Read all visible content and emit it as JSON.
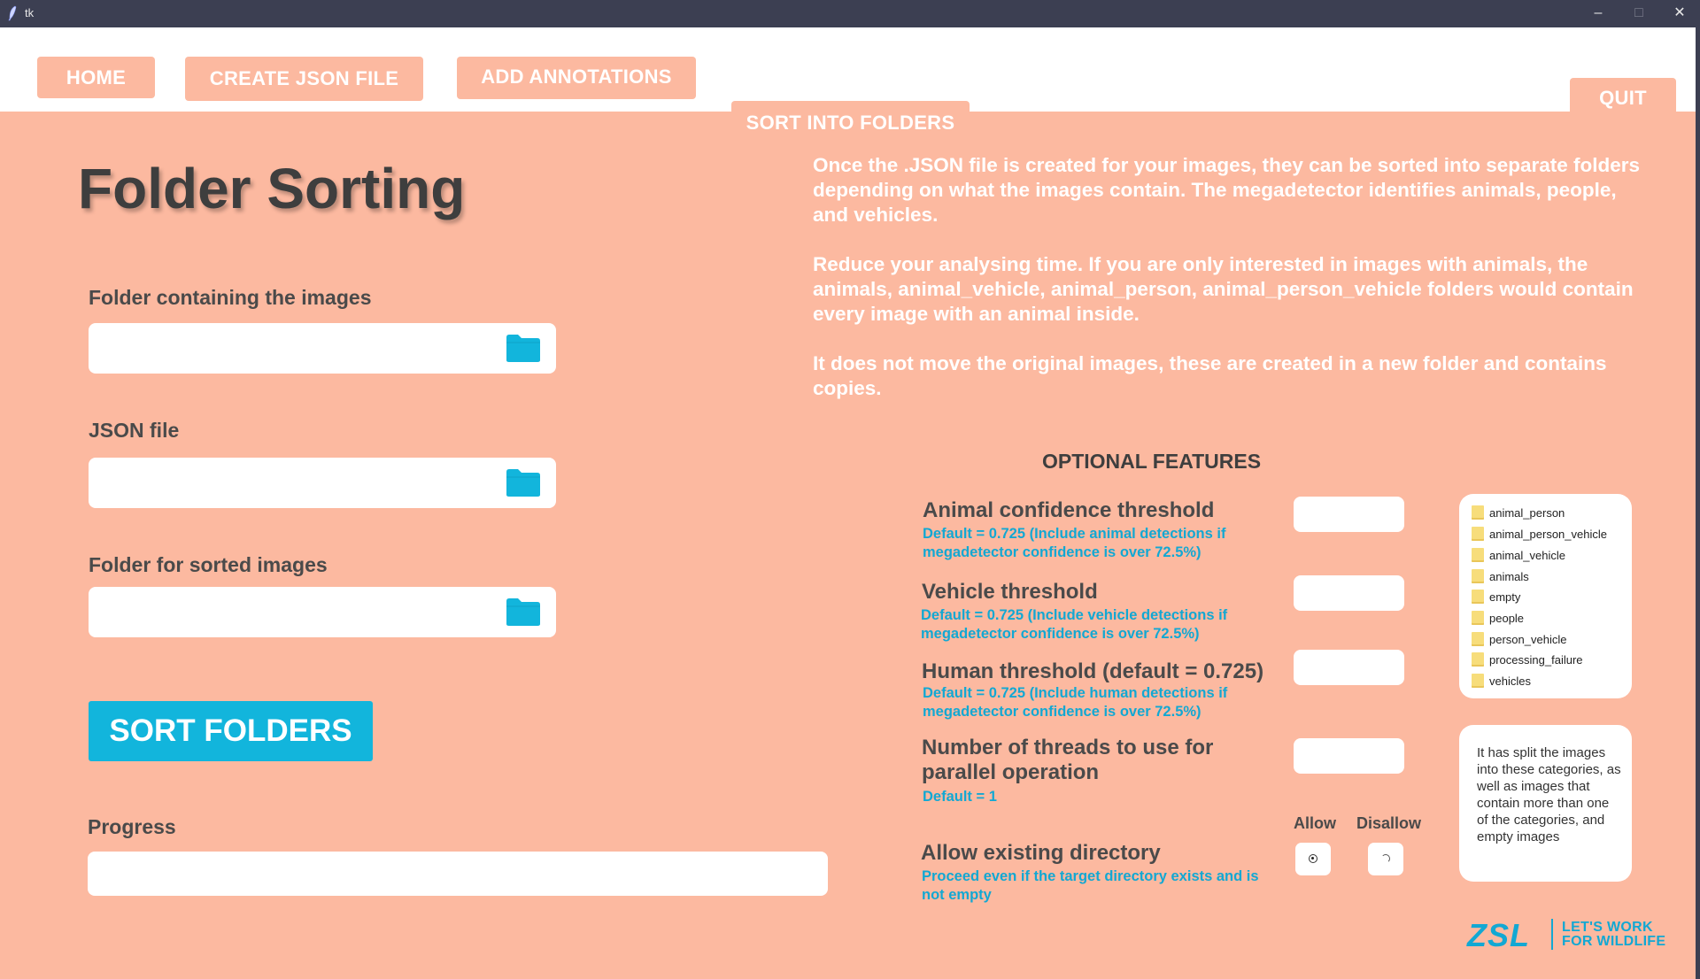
{
  "window": {
    "title": "tk",
    "minimize_glyph": "–",
    "maximize_glyph": "□",
    "close_glyph": "✕"
  },
  "tabs": {
    "home": "HOME",
    "create_json": "CREATE JSON FILE",
    "add_annotations": "ADD ANNOTATIONS",
    "sort_into_folders": "SORT INTO FOLDERS",
    "quit": "QUIT"
  },
  "page": {
    "title": "Folder Sorting",
    "images_folder_label": "Folder containing the images",
    "images_folder_value": "",
    "json_file_label": "JSON file",
    "json_file_value": "",
    "sorted_folder_label": "Folder for sorted images",
    "sorted_folder_value": "",
    "sort_button": "SORT FOLDERS",
    "progress_label": "Progress",
    "progress_value": 0
  },
  "description": {
    "p1": "Once the .JSON file is created for your images, they can be sorted into separate folders depending on what the images contain. The megadetector identifies animals, people, and vehicles.",
    "p2": "Reduce your analysing time. If you are only interested in images with animals, the animals, animal_vehicle, animal_person, animal_person_vehicle folders would contain every image with an animal inside.",
    "p3": "It does not move the original images, these are created in a new folder and contains copies."
  },
  "optional": {
    "heading": "OPTIONAL FEATURES",
    "animal_title": "Animal confidence threshold",
    "animal_note": "Default = 0.725 (Include animal detections if megadetector confidence is over 72.5%)",
    "animal_value": "",
    "vehicle_title": "Vehicle threshold",
    "vehicle_note": "Default = 0.725 (Include vehicle detections if megadetector confidence is over 72.5%)",
    "vehicle_value": "",
    "human_title": "Human threshold (default  = 0.725)",
    "human_note": "Default = 0.725 (Include human detections if megadetector confidence is over 72.5%)",
    "human_value": "",
    "threads_title": "Number of threads to use for parallel operation",
    "threads_note": "Default = 1",
    "threads_value": "",
    "allow_title": "Allow existing directory",
    "allow_note": "Proceed even if the target directory exists and is not empty",
    "allow_label": "Allow",
    "disallow_label": "Disallow",
    "selected": "allow"
  },
  "folders": [
    "animal_person",
    "animal_person_vehicle",
    "animal_vehicle",
    "animals",
    "empty",
    "people",
    "person_vehicle",
    "processing_failure",
    "vehicles"
  ],
  "folders_note": "It has split the images into these categories, as well as images that contain more than one of the categories, and empty images",
  "logo": {
    "mark": "ZSL",
    "tagline_1": "LET'S WORK",
    "tagline_2": "FOR WILDLIFE"
  },
  "colors": {
    "accent": "#12b5dc",
    "background": "#fcb9a0",
    "titlebar": "#3c3f52"
  },
  "icons": {
    "folder": "folder-icon",
    "app": "feather-icon"
  }
}
